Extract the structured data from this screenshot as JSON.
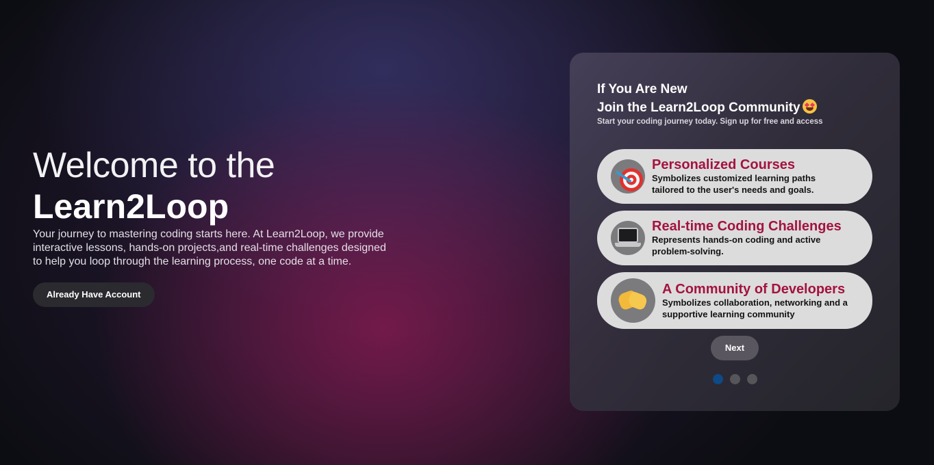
{
  "hero": {
    "title_line1": "Welcome to the",
    "title_line2": "Learn2Loop",
    "description": "Your journey to mastering coding starts here. At Learn2Loop, we provide interactive lessons, hands-on projects,and real-time challenges designed to help you loop through the learning process, one code at a time.",
    "button_label": "Already Have Account"
  },
  "card": {
    "title_line1": "If You Are New",
    "title_line2": "Join the Learn2Loop Community",
    "title_emoji": "star-struck-emoji",
    "subtitle": "Start your coding journey today. Sign up for free and access",
    "features": [
      {
        "icon": "target-dart-icon",
        "title": "Personalized Courses",
        "desc_line1": "Symbolizes customized learning paths",
        "desc_line2": "tailored to the user's needs and goals."
      },
      {
        "icon": "laptop-icon",
        "title": "Real-time Coding Challenges",
        "desc_line1": "Represents hands-on coding and active",
        "desc_line2": "problem-solving."
      },
      {
        "icon": "handshake-icon",
        "title": "A Community of Developers",
        "desc_line1": "Symbolizes collaboration, networking and a",
        "desc_line2": "supportive learning community"
      }
    ],
    "next_label": "Next",
    "pagination": {
      "total": 3,
      "active": 1
    }
  },
  "colors": {
    "accent_title": "#a3133f",
    "active_dot": "#0e4a86",
    "pill_bg": "#dcdcdc"
  }
}
